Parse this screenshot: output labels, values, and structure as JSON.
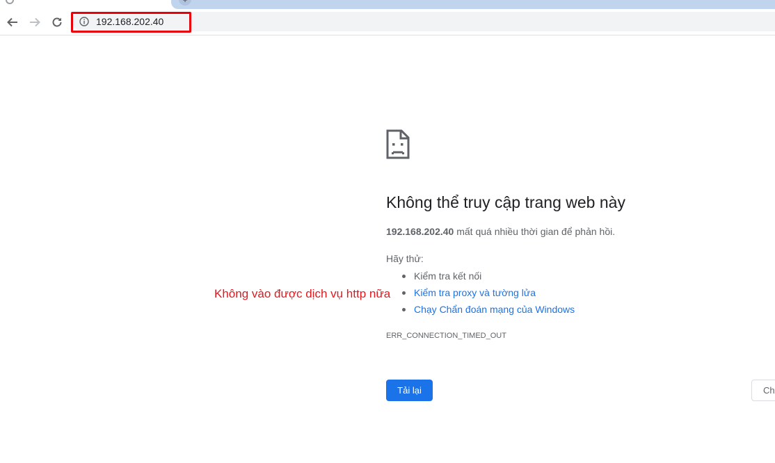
{
  "browser": {
    "url": "192.168.202.40"
  },
  "error_page": {
    "title": "Không thể truy cập trang web này",
    "host": "192.168.202.40",
    "description": "mất quá nhiều thời gian để phản hồi.",
    "try_label": "Hãy thử:",
    "suggestions": [
      "Kiểm tra kết nối",
      "Kiểm tra proxy và tường lửa",
      "Chạy Chẩn đoán mạng của Windows"
    ],
    "error_code": "ERR_CONNECTION_TIMED_OUT",
    "reload_label": "Tải lại",
    "details_label": "Ch"
  },
  "annotation": {
    "text": "Không vào được dịch vụ http nữa",
    "color": "#e0191f"
  },
  "colors": {
    "accent": "#1a73e8",
    "highlight_box": "#e8000b"
  }
}
